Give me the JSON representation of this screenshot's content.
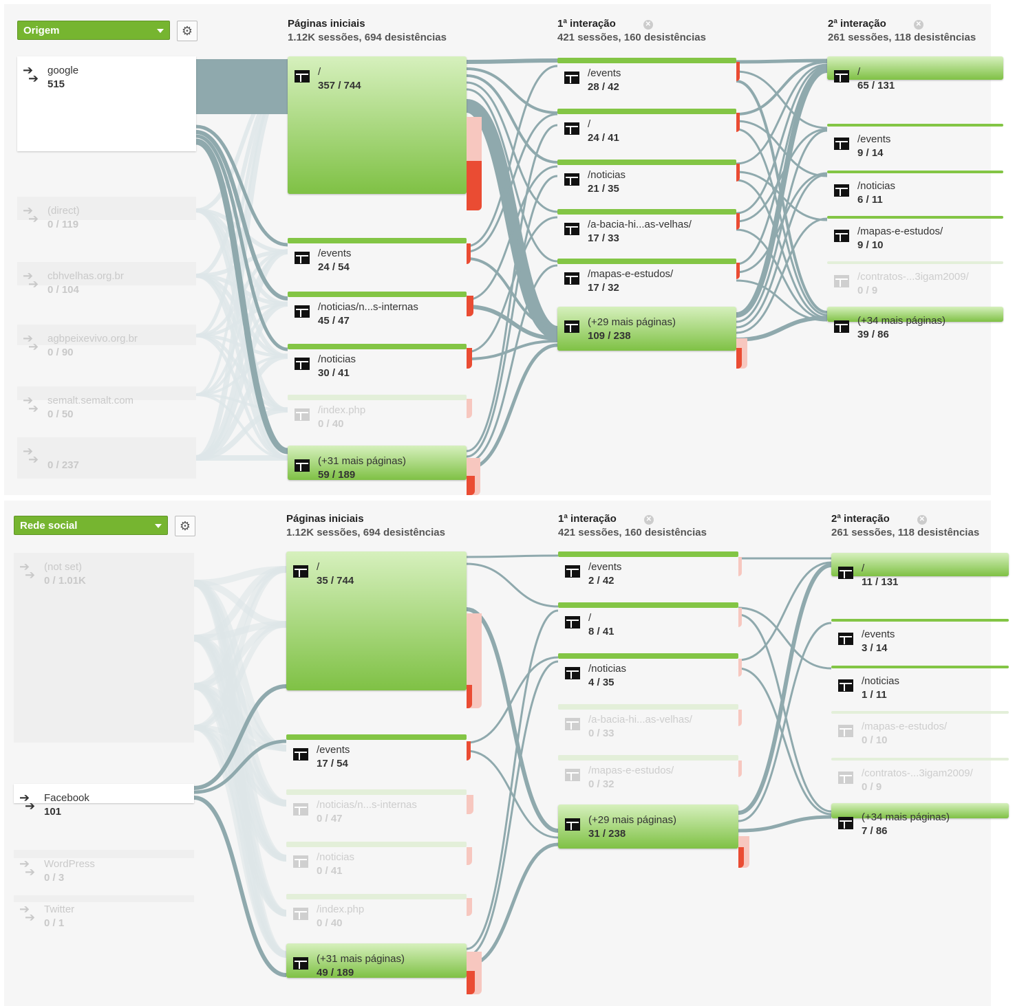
{
  "colors": {
    "accent": "#76b530",
    "flow": "#8fa9ad",
    "drop": "#ea4c33",
    "dim_text": "#c9c9c9"
  },
  "panel1": {
    "dropdown": "Origem",
    "gear_icon": "gear-icon",
    "cols": [
      {
        "title": "Páginas iniciais",
        "sub": "1.12K sessões, 694 desistências"
      },
      {
        "title": "1ª interação",
        "sub": "421 sessões, 160 desistências"
      },
      {
        "title": "2ª interação",
        "sub": "261 sessões, 118 desistências"
      }
    ],
    "sources": [
      {
        "name": "google",
        "count": "515"
      },
      {
        "name": "(direct)",
        "count": "0 / 119"
      },
      {
        "name": "cbhvelhas.org.br",
        "count": "0 / 104"
      },
      {
        "name": "agbpeixevivo.org.br",
        "count": "0 / 90"
      },
      {
        "name": "semalt.semalt.com",
        "count": "0 / 50"
      },
      {
        "name": "",
        "count": "0 / 237"
      }
    ],
    "start": [
      {
        "label": "/",
        "count": "357 / 744"
      },
      {
        "label": "/events",
        "count": "24 / 54"
      },
      {
        "label": "/noticias/n...s-internas",
        "count": "45 / 47"
      },
      {
        "label": "/noticias",
        "count": "30 / 41"
      },
      {
        "label": "/index.php",
        "count": "0 / 40"
      },
      {
        "label": "(+31 mais páginas)",
        "count": "59 / 189"
      }
    ],
    "i1": [
      {
        "label": "/events",
        "count": "28 / 42"
      },
      {
        "label": "/",
        "count": "24 / 41"
      },
      {
        "label": "/noticias",
        "count": "21 / 35"
      },
      {
        "label": "/a-bacia-hi...as-velhas/",
        "count": "17 / 33"
      },
      {
        "label": "/mapas-e-estudos/",
        "count": "17 / 32"
      },
      {
        "label": "(+29 mais páginas)",
        "count": "109 / 238"
      }
    ],
    "i2": [
      {
        "label": "/",
        "count": "65 / 131"
      },
      {
        "label": "/events",
        "count": "9 / 14"
      },
      {
        "label": "/noticias",
        "count": "6 / 11"
      },
      {
        "label": "/mapas-e-estudos/",
        "count": "9 / 10"
      },
      {
        "label": "/contratos-...3igam2009/",
        "count": "0 / 9"
      },
      {
        "label": "(+34 mais páginas)",
        "count": "39 / 86"
      }
    ]
  },
  "panel2": {
    "dropdown": "Rede social",
    "gear_icon": "gear-icon",
    "cols": [
      {
        "title": "Páginas iniciais",
        "sub": "1.12K sessões, 694 desistências"
      },
      {
        "title": "1ª interação",
        "sub": "421 sessões, 160 desistências"
      },
      {
        "title": "2ª interação",
        "sub": "261 sessões, 118 desistências"
      }
    ],
    "sources": [
      {
        "name": "(not set)",
        "count": "0 / 1.01K"
      },
      {
        "name": "Facebook",
        "count": "101"
      },
      {
        "name": "WordPress",
        "count": "0 / 3"
      },
      {
        "name": "Twitter",
        "count": "0 / 1"
      }
    ],
    "start": [
      {
        "label": "/",
        "count": "35 / 744"
      },
      {
        "label": "/events",
        "count": "17 / 54"
      },
      {
        "label": "/noticias/n...s-internas",
        "count": "0 / 47"
      },
      {
        "label": "/noticias",
        "count": "0 / 41"
      },
      {
        "label": "/index.php",
        "count": "0 / 40"
      },
      {
        "label": "(+31 mais páginas)",
        "count": "49 / 189"
      }
    ],
    "i1": [
      {
        "label": "/events",
        "count": "2 / 42"
      },
      {
        "label": "/",
        "count": "8 / 41"
      },
      {
        "label": "/noticias",
        "count": "4 / 35"
      },
      {
        "label": "/a-bacia-hi...as-velhas/",
        "count": "0 / 33"
      },
      {
        "label": "/mapas-e-estudos/",
        "count": "0 / 32"
      },
      {
        "label": "(+29 mais páginas)",
        "count": "31 / 238"
      }
    ],
    "i2": [
      {
        "label": "/",
        "count": "11 / 131"
      },
      {
        "label": "/events",
        "count": "3 / 14"
      },
      {
        "label": "/noticias",
        "count": "1 / 11"
      },
      {
        "label": "/mapas-e-estudos/",
        "count": "0 / 10"
      },
      {
        "label": "/contratos-...3igam2009/",
        "count": "0 / 9"
      },
      {
        "label": "(+34 mais páginas)",
        "count": "7 / 86"
      }
    ]
  }
}
